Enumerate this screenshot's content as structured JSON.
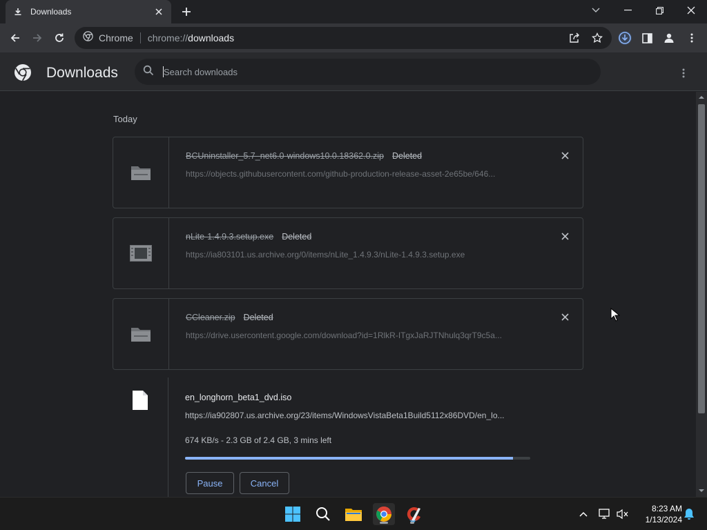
{
  "browser": {
    "tab_title": "Downloads",
    "omnibox_site": "Chrome",
    "omnibox_scheme": "chrome://",
    "omnibox_host": "downloads"
  },
  "page": {
    "title": "Downloads",
    "search_placeholder": "Search downloads"
  },
  "downloads": {
    "section_date": "Today",
    "items": [
      {
        "filename": "BCUninstaller_5.7_net6.0-windows10.0.18362.0.zip",
        "status": "Deleted",
        "url": "https://objects.githubusercontent.com/github-production-release-asset-2e65be/646...",
        "icon": "zip-folder-icon"
      },
      {
        "filename": "nLite-1.4.9.3.setup.exe",
        "status": "Deleted",
        "url": "https://ia803101.us.archive.org/0/items/nLite_1.4.9.3/nLite-1.4.9.3.setup.exe",
        "icon": "exe-app-icon"
      },
      {
        "filename": "CCleaner.zip",
        "status": "Deleted",
        "url": "https://drive.usercontent.google.com/download?id=1RlkR-ITgxJaRJTNhulq3qrT9c5a...",
        "icon": "zip-folder-icon"
      }
    ],
    "active": {
      "filename": "en_longhorn_beta1_dvd.iso",
      "url": "https://ia902807.us.archive.org/23/items/WindowsVistaBeta1Build5112x86DVD/en_lo...",
      "progress_text": "674 KB/s - 2.3 GB of 2.4 GB, 3 mins left",
      "progress_fraction": 0.95,
      "pause_label": "Pause",
      "cancel_label": "Cancel",
      "icon": "file-icon"
    }
  },
  "taskbar": {
    "time": "8:23 AM",
    "date": "1/13/2024"
  },
  "colors": {
    "accent": "#8ab4f8",
    "background": "#202124",
    "toolbar": "#35363a"
  }
}
